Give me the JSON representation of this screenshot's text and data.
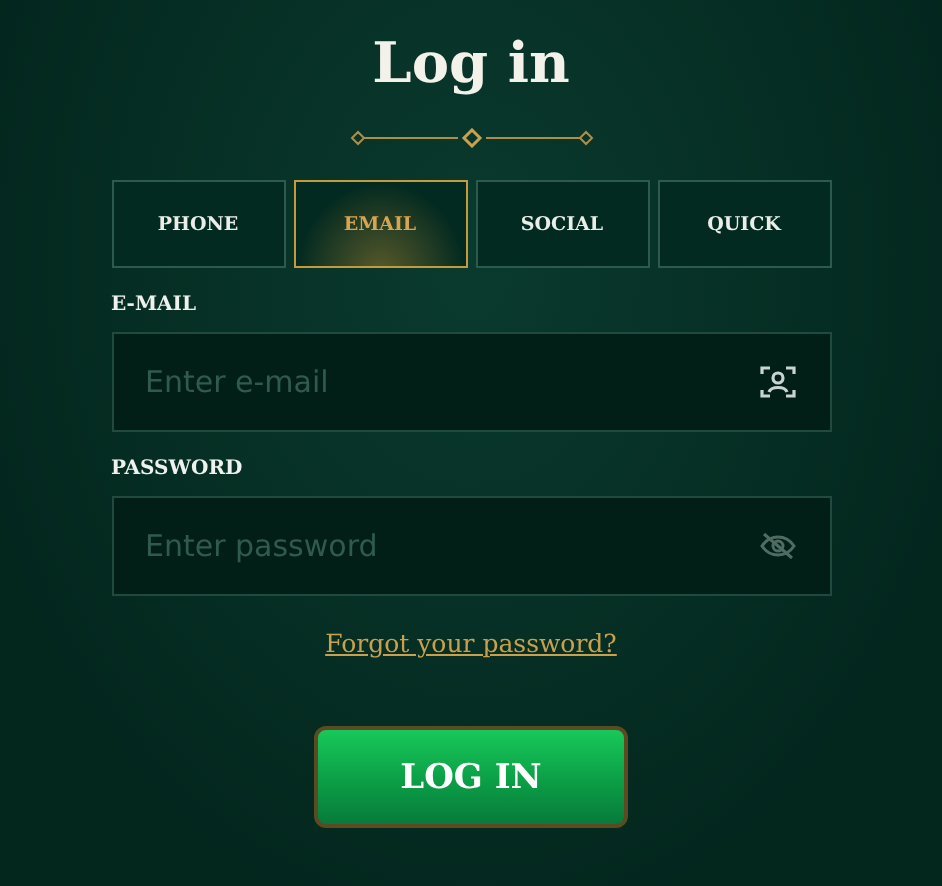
{
  "title": "Log in",
  "tabs": [
    {
      "label": "PHONE",
      "selected": false
    },
    {
      "label": "EMAIL",
      "selected": true
    },
    {
      "label": "SOCIAL",
      "selected": false
    },
    {
      "label": "QUICK",
      "selected": false
    }
  ],
  "fields": [
    {
      "label": "E-MAIL",
      "placeholder": "Enter e-mail",
      "kind": "email"
    },
    {
      "label": "PASSWORD",
      "placeholder": "Enter password",
      "kind": "password"
    }
  ],
  "forgot_link": "Forgot your password?",
  "submit": "LOG IN"
}
